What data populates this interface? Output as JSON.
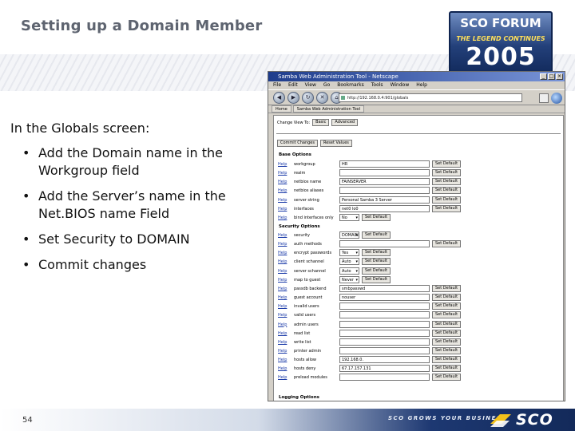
{
  "slide": {
    "title": "Setting up a Domain Member",
    "intro": "In the Globals screen:",
    "bullets": [
      "Add the Domain name in the Workgroup field",
      "Add the Server’s name in the Net.BIOS name Field",
      "Set Security to DOMAIN",
      "Commit changes"
    ],
    "bullet_glyph": "•",
    "page_number": "54"
  },
  "logo": {
    "top": "SCO FORUM",
    "subtitle": "THE LEGEND CONTINUES",
    "year": "2005"
  },
  "footer": {
    "tagline": "SCO GROWS YOUR BUSINESS",
    "brand": "SCO"
  },
  "browser": {
    "window_title": "Samba Web Administration Tool - Netscape",
    "window_buttons": [
      "_",
      "□",
      "×"
    ],
    "menus": [
      "File",
      "Edit",
      "View",
      "Go",
      "Bookmarks",
      "Tools",
      "Window",
      "Help"
    ],
    "nav_icons": [
      "back-icon",
      "forward-icon",
      "reload-icon",
      "stop-icon",
      "home-icon"
    ],
    "nav_glyphs": [
      "◀",
      "▶",
      "↻",
      "✕",
      "⌂"
    ],
    "url": "http://192.168.0.4:901/globals",
    "tabs": [
      "Home",
      "Samba Web Administration Tool"
    ],
    "change_view_label": "Change View To:",
    "basic_button": "Basic",
    "advanced_button": "Advanced",
    "commit_button": "Commit Changes",
    "reset_button": "Reset Values",
    "help_label": "Help",
    "set_default_label": "Set Default",
    "sections": {
      "base": "Base Options",
      "security": "Security Options",
      "logging": "Logging Options"
    },
    "base_options": [
      {
        "name": "workgroup",
        "value": "HR"
      },
      {
        "name": "realm",
        "value": ""
      },
      {
        "name": "netbios name",
        "value": "FAINSERVER"
      },
      {
        "name": "netbios aliases",
        "value": ""
      },
      {
        "name": "server string",
        "value": "Personal Samba 3 Server"
      },
      {
        "name": "interfaces",
        "value": "net0 lo0"
      },
      {
        "name": "bind interfaces only",
        "value": "No"
      }
    ],
    "security_options": [
      {
        "name": "security",
        "value": "DOMAIN"
      },
      {
        "name": "auth methods",
        "value": ""
      },
      {
        "name": "encrypt passwords",
        "value": "Yes"
      },
      {
        "name": "client schannel",
        "value": "Auto"
      },
      {
        "name": "server schannel",
        "value": "Auto"
      },
      {
        "name": "map to guest",
        "value": "Never"
      },
      {
        "name": "passdb backend",
        "value": "smbpasswd"
      },
      {
        "name": "guest account",
        "value": "nouser"
      },
      {
        "name": "invalid users",
        "value": ""
      },
      {
        "name": "valid users",
        "value": ""
      },
      {
        "name": "admin users",
        "value": ""
      },
      {
        "name": "read list",
        "value": ""
      },
      {
        "name": "write list",
        "value": ""
      },
      {
        "name": "printer admin",
        "value": ""
      },
      {
        "name": "hosts allow",
        "value": "192.168.0."
      },
      {
        "name": "hosts deny",
        "value": "67.17.157.131"
      },
      {
        "name": "preload modules",
        "value": ""
      }
    ]
  }
}
